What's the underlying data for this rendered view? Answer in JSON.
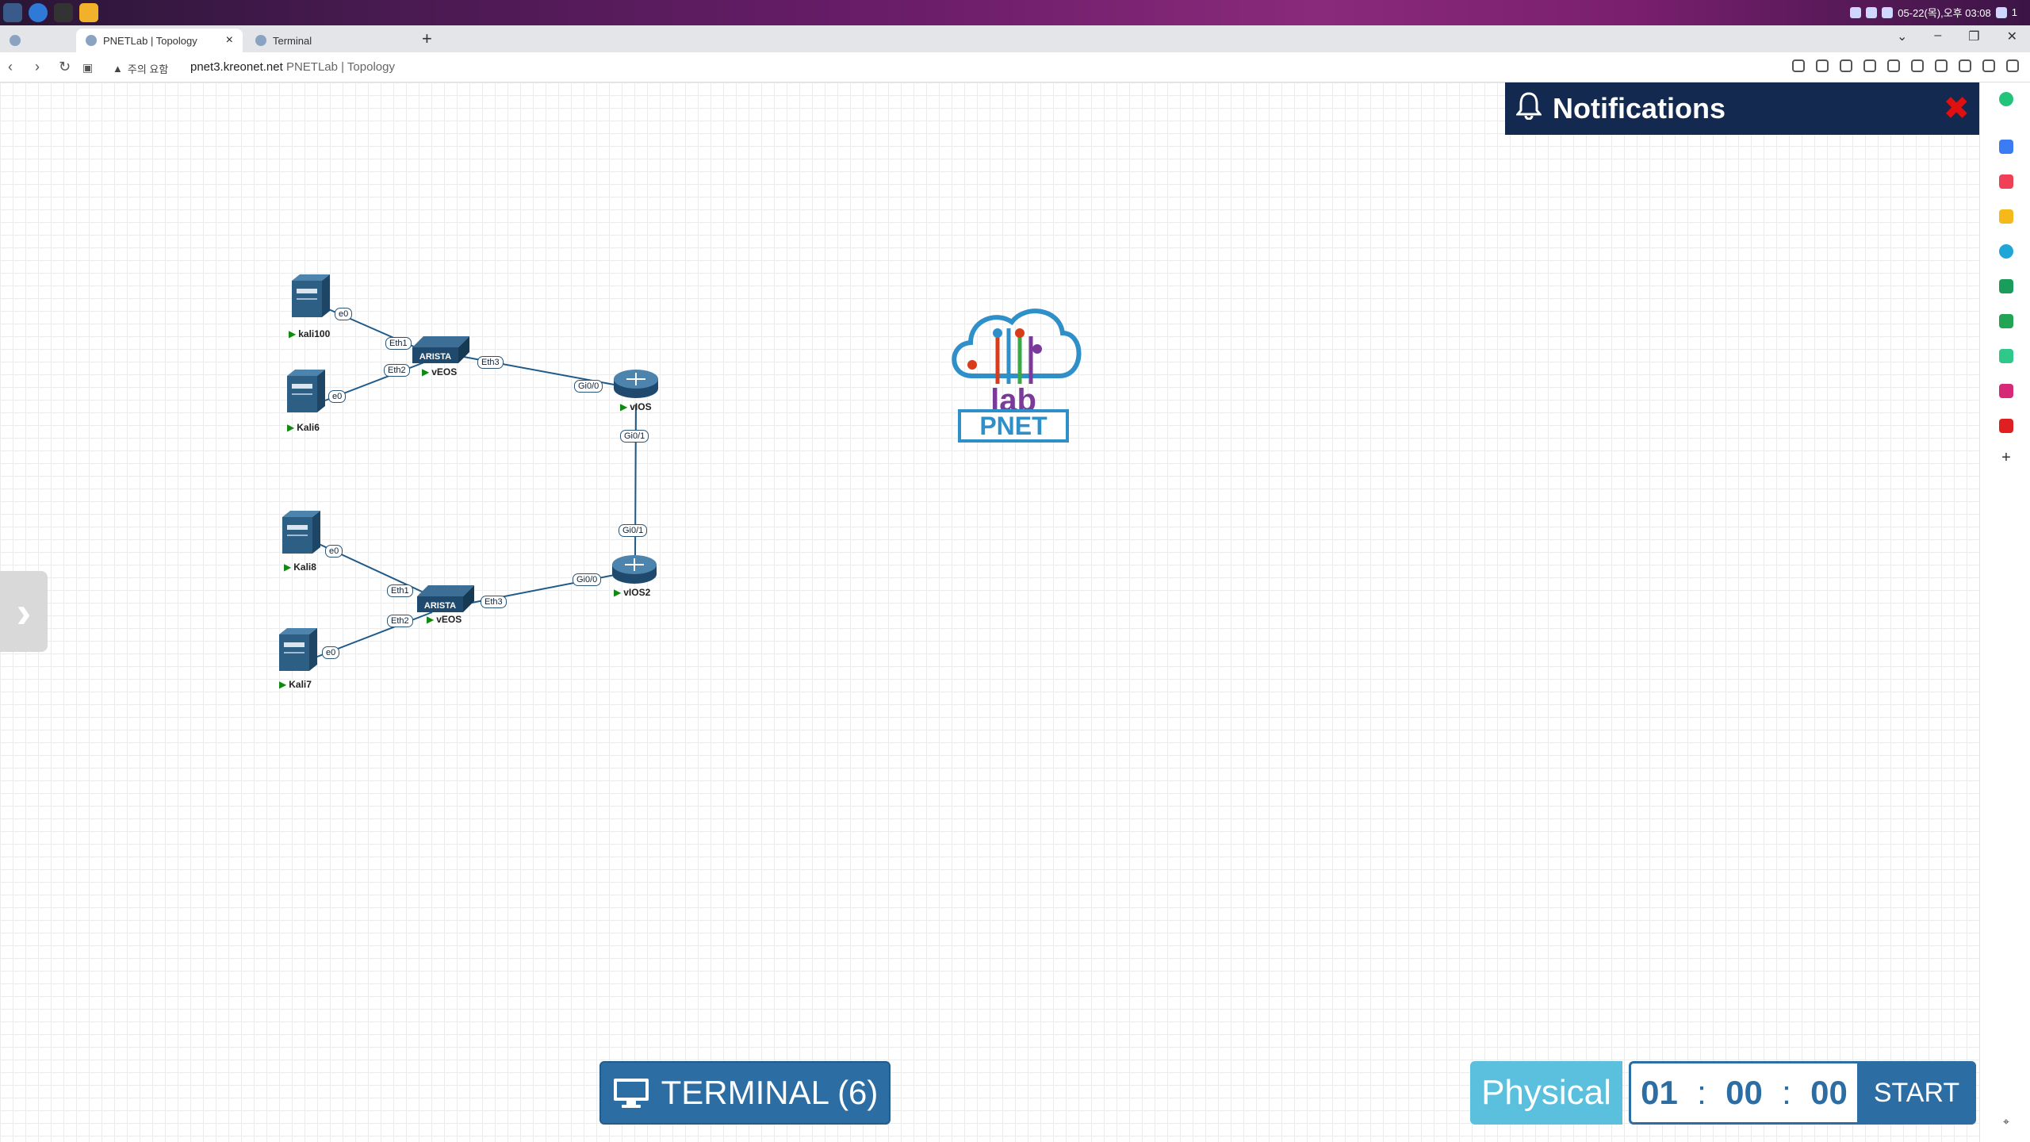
{
  "os": {
    "clock": "05-22(목),오후 03:08",
    "tray_extra": "1"
  },
  "tabs": [
    {
      "title": "PNETLab | Topology",
      "close": "×"
    },
    {
      "title": "Terminal"
    }
  ],
  "new_tab_label": "+",
  "window_controls": [
    "⌄",
    "–",
    "❐",
    "✕"
  ],
  "address": {
    "warning": "주의 요함",
    "host": "pnet3.kreonet.net",
    "path_title": "PNETLab | Topology"
  },
  "notifications": {
    "title": "Notifications",
    "close": "✖"
  },
  "logo": {
    "text": "PNET",
    "sub": "lab"
  },
  "nodes": {
    "kali100": {
      "label": "kali100",
      "port": "e0"
    },
    "kali6": {
      "label": "Kali6",
      "port": "e0"
    },
    "veos1": {
      "label": "vEOS",
      "brand": "ARISTA",
      "ports": [
        "Eth1",
        "Eth2",
        "Eth3"
      ]
    },
    "vios": {
      "label": "vIOS",
      "ports": [
        "Gi0/0",
        "Gi0/1"
      ]
    },
    "kali8": {
      "label": "Kali8",
      "port": "e0"
    },
    "kali7": {
      "label": "Kali7",
      "port": "e0"
    },
    "veos2": {
      "label": "vEOS",
      "brand": "ARISTA",
      "ports": [
        "Eth1",
        "Eth2",
        "Eth3"
      ]
    },
    "vios2": {
      "label": "vIOS2",
      "ports": [
        "Gi0/0",
        "Gi0/1"
      ]
    }
  },
  "controls": {
    "terminal": "TERMINAL (6)",
    "physical": "Physical",
    "timer_h": "01",
    "timer_m": "00",
    "timer_s": "00",
    "start": "START"
  },
  "colors": {
    "accent": "#2c6da3",
    "physical": "#5bc0de",
    "notif_bg": "#14294f",
    "close_red": "#e01010",
    "running": "#0f8a0f"
  }
}
